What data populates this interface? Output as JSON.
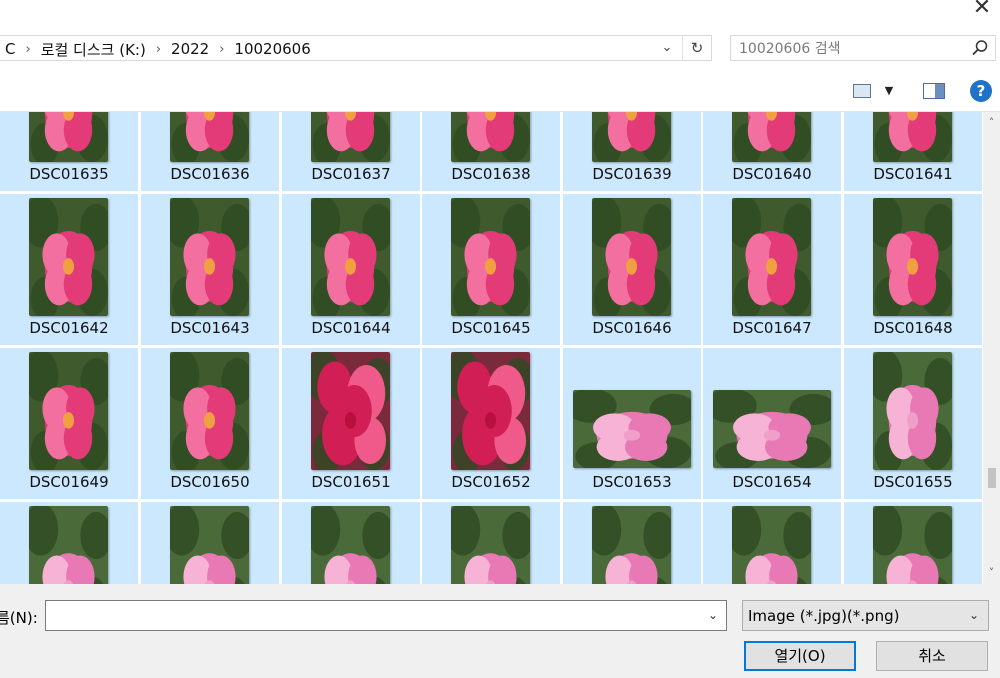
{
  "window": {
    "close_glyph": "✕"
  },
  "address": {
    "crumbs": [
      "C",
      "로컬 디스크 (K:)",
      "2022",
      "10020606"
    ],
    "separator": "›",
    "dropdown_glyph": "⌄",
    "refresh_glyph": "↻"
  },
  "search": {
    "placeholder": "10020606 검색",
    "icon": "search-icon"
  },
  "toolbar": {
    "view_icon": "change-view-icon",
    "view_dropdown_glyph": "▼",
    "preview_pane_icon": "preview-pane-icon",
    "help_label": "?"
  },
  "files": [
    {
      "name": "DSC01635",
      "orientation": "portrait",
      "kind": "red-top"
    },
    {
      "name": "DSC01636",
      "orientation": "portrait",
      "kind": "red-top"
    },
    {
      "name": "DSC01637",
      "orientation": "portrait",
      "kind": "red-top"
    },
    {
      "name": "DSC01638",
      "orientation": "portrait",
      "kind": "red-top"
    },
    {
      "name": "DSC01639",
      "orientation": "portrait",
      "kind": "red-top"
    },
    {
      "name": "DSC01640",
      "orientation": "portrait",
      "kind": "red-top"
    },
    {
      "name": "DSC01641",
      "orientation": "portrait",
      "kind": "red-top"
    },
    {
      "name": "DSC01642",
      "orientation": "portrait",
      "kind": "red"
    },
    {
      "name": "DSC01643",
      "orientation": "portrait",
      "kind": "red"
    },
    {
      "name": "DSC01644",
      "orientation": "portrait",
      "kind": "red"
    },
    {
      "name": "DSC01645",
      "orientation": "portrait",
      "kind": "red"
    },
    {
      "name": "DSC01646",
      "orientation": "portrait",
      "kind": "red"
    },
    {
      "name": "DSC01647",
      "orientation": "portrait",
      "kind": "red"
    },
    {
      "name": "DSC01648",
      "orientation": "portrait",
      "kind": "red"
    },
    {
      "name": "DSC01649",
      "orientation": "portrait",
      "kind": "red"
    },
    {
      "name": "DSC01650",
      "orientation": "portrait",
      "kind": "red"
    },
    {
      "name": "DSC01651",
      "orientation": "portrait",
      "kind": "cluster"
    },
    {
      "name": "DSC01652",
      "orientation": "portrait",
      "kind": "cluster"
    },
    {
      "name": "DSC01653",
      "orientation": "landscape",
      "kind": "pink"
    },
    {
      "name": "DSC01654",
      "orientation": "landscape",
      "kind": "pink"
    },
    {
      "name": "DSC01655",
      "orientation": "portrait",
      "kind": "pink"
    },
    {
      "name": "",
      "orientation": "portrait",
      "kind": "pink-partial"
    },
    {
      "name": "",
      "orientation": "portrait",
      "kind": "pink-partial"
    },
    {
      "name": "",
      "orientation": "portrait",
      "kind": "pink-partial"
    },
    {
      "name": "",
      "orientation": "portrait",
      "kind": "pink-partial"
    },
    {
      "name": "",
      "orientation": "portrait",
      "kind": "pink-partial"
    },
    {
      "name": "",
      "orientation": "portrait",
      "kind": "pink-partial"
    },
    {
      "name": "",
      "orientation": "portrait",
      "kind": "pink-partial"
    }
  ],
  "scrollbar": {
    "up_glyph": "˄",
    "down_glyph": "˅"
  },
  "footer": {
    "filename_label": "름(N):",
    "filename_value": "",
    "filename_dropdown_glyph": "⌄",
    "filetype_value": "Image (*.jpg)(*.png)",
    "filetype_dropdown_glyph": "⌄",
    "open_label": "열기(O)",
    "cancel_label": "취소"
  },
  "colors": {
    "selection": "#cce8ff",
    "accent": "#0078d7",
    "help": "#1e72c8"
  }
}
